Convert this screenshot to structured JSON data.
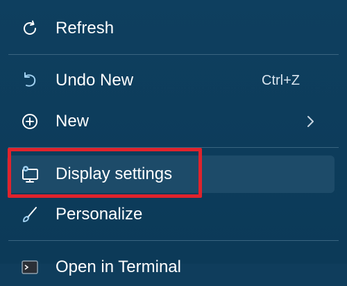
{
  "menu": {
    "items": [
      {
        "label": "Refresh",
        "icon": "refresh-icon"
      },
      {
        "label": "Undo New",
        "icon": "undo-icon",
        "shortcut": "Ctrl+Z"
      },
      {
        "label": "New",
        "icon": "plus-circle-icon",
        "submenu": true
      },
      {
        "label": "Display settings",
        "icon": "display-settings-icon",
        "highlighted": true
      },
      {
        "label": "Personalize",
        "icon": "brush-icon"
      },
      {
        "label": "Open in Terminal",
        "icon": "terminal-icon"
      }
    ]
  },
  "colors": {
    "background": "#0f3d5c",
    "hover": "#1d4b69",
    "annotation": "#e0232c",
    "icon": "#9fd0f0"
  }
}
